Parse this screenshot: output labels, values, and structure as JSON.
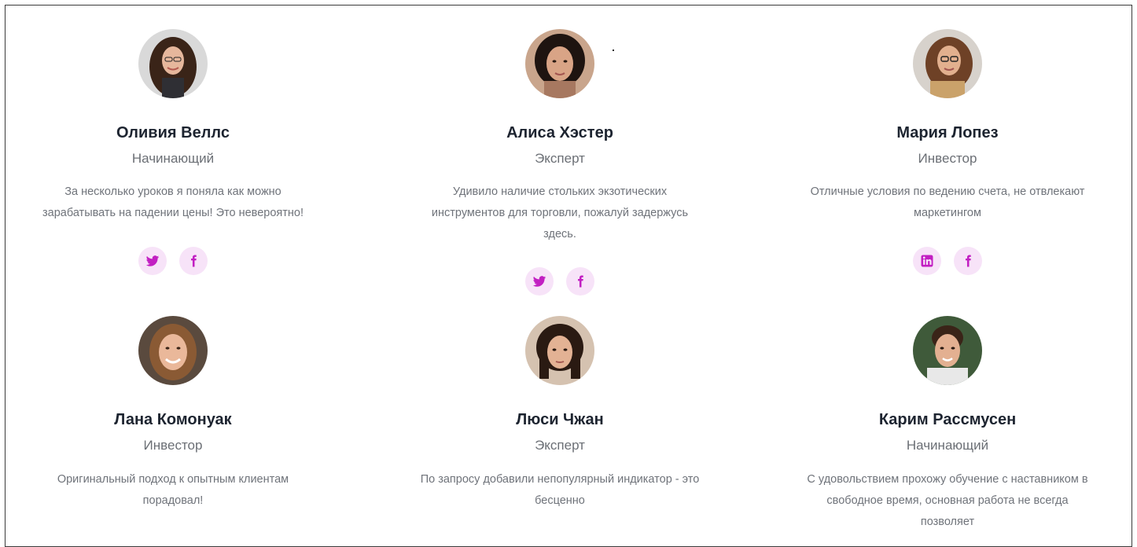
{
  "accent_color": "#c21fc2",
  "social_bg_color": "#f7e3f8",
  "testimonials": [
    {
      "name": "Оливия Веллс",
      "role": "Начинающий",
      "quote_lines": [
        "За несколько уроков я поняла как можно",
        "зарабатывать на падении цены! Это невероятно!"
      ],
      "socials": [
        "twitter-icon",
        "facebook-icon"
      ]
    },
    {
      "name": "Алиса Хэстер",
      "role": "Эксперт",
      "quote_lines": [
        "Удивило наличие стольких экзотических",
        "инструментов для торговли, пожалуй задержусь",
        "здесь."
      ],
      "socials": [
        "twitter-icon",
        "facebook-icon"
      ]
    },
    {
      "name": "Мария Лопез",
      "role": "Инвестор",
      "quote_lines": [
        "Отличные условия по ведению счета, не отвлекают",
        "маркетингом"
      ],
      "socials": [
        "linkedin-icon",
        "facebook-icon"
      ]
    },
    {
      "name": "Лана Комонуак",
      "role": "Инвестор",
      "quote_lines": [
        "Оригинальный подход к опытным клиентам",
        "порадовал!"
      ],
      "socials": []
    },
    {
      "name": "Люси Чжан",
      "role": "Эксперт",
      "quote_lines": [
        "По запросу добавили непопулярный индикатор - это",
        "бесценно"
      ],
      "socials": []
    },
    {
      "name": "Карим Рассмусен",
      "role": "Начинающий",
      "quote_lines": [
        "С удовольствием прохожу обучение с наставником в",
        "свободное время, основная работа не всегда",
        "позволяет"
      ],
      "socials": []
    }
  ]
}
